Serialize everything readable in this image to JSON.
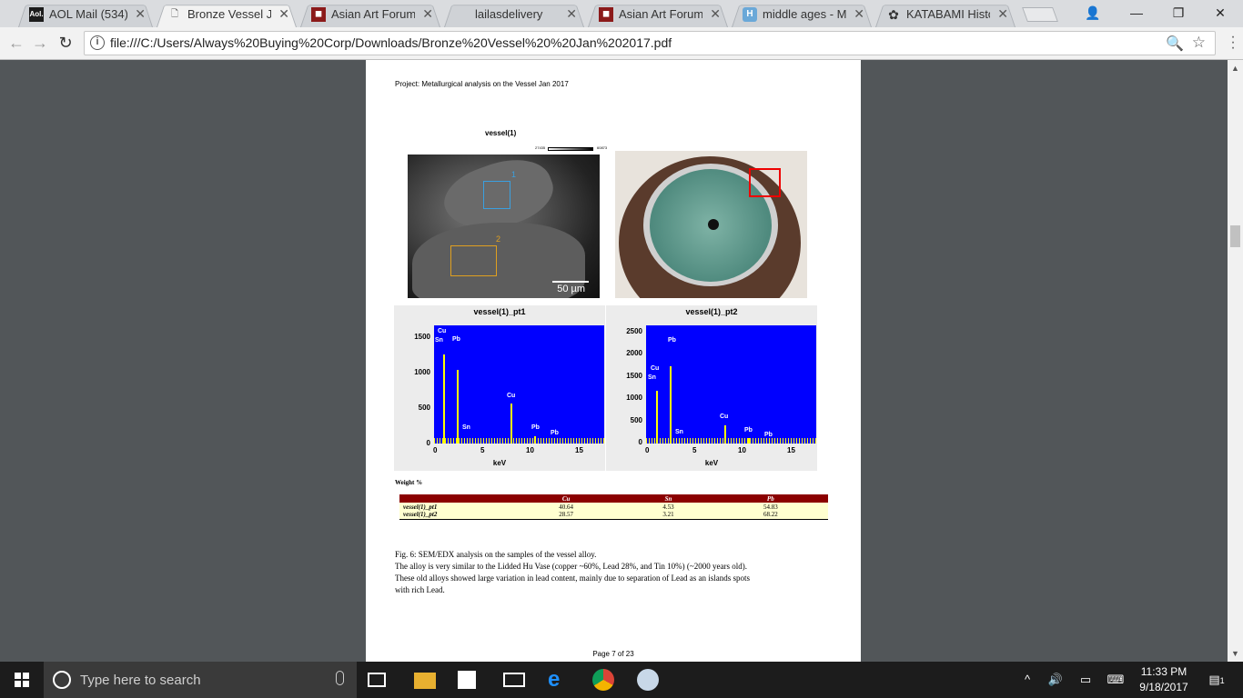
{
  "browser": {
    "tabs": [
      {
        "title": "AOL Mail (534)",
        "icon": "aol-icon",
        "active": false
      },
      {
        "title": "Bronze Vessel Jan",
        "icon": "document-icon",
        "active": true
      },
      {
        "title": "Asian Art Forums -",
        "icon": "forum-icon",
        "active": false
      },
      {
        "title": "lailasdelivery",
        "icon": "",
        "active": false
      },
      {
        "title": "Asian Art Forums -",
        "icon": "forum-icon",
        "active": false
      },
      {
        "title": "middle ages - Me",
        "icon": "h-icon",
        "active": false
      },
      {
        "title": "KATABAMI History",
        "icon": "crest-icon",
        "active": false
      }
    ],
    "url": "file:///C:/Users/Always%20Buying%20Corp/Downloads/Bronze%20Vessel%20%20Jan%202017.pdf"
  },
  "pdf": {
    "project_title": "Project: Metallurgical analysis on the Vessel Jan 2017",
    "sem_title": "vessel(1)",
    "scalebar_min": "27435",
    "scalebar_max": "60873",
    "roi1": "1",
    "roi2": "2",
    "sem_scale": "50 µm",
    "spectra": [
      {
        "title": "vessel(1)_pt1",
        "xlabel": "keV",
        "yticks": [
          "1500",
          "1000",
          "500",
          "0"
        ],
        "xticks": [
          "0",
          "5",
          "10",
          "15"
        ],
        "labels": [
          "Cu",
          "Sn",
          "Pb",
          "Cu",
          "Sn",
          "Pb",
          "Pb"
        ]
      },
      {
        "title": "vessel(1)_pt2",
        "xlabel": "keV",
        "yticks": [
          "2500",
          "2000",
          "1500",
          "1000",
          "500",
          "0"
        ],
        "xticks": [
          "0",
          "5",
          "10",
          "15"
        ],
        "labels": [
          "Pb",
          "Cu",
          "Sn",
          "Cu",
          "Sn",
          "Pb",
          "Pb"
        ]
      }
    ],
    "weight_label": "Weight %",
    "table": {
      "headers": [
        "",
        "Cu",
        "Sn",
        "Pb"
      ],
      "rows": [
        [
          "vessel(1)_pt1",
          "40.64",
          "4.53",
          "54.83"
        ],
        [
          "vessel(1)_pt2",
          "28.57",
          "3.21",
          "68.22"
        ]
      ]
    },
    "caption": [
      "Fig. 6: SEM/EDX analysis on the samples of the vessel alloy.",
      "The alloy is very similar to the Lidded Hu Vase (copper ~60%, Lead 28%, and Tin 10%) (~2000 years old).",
      "These old alloys showed large variation in lead content, mainly due to separation of Lead as an islands spots",
      "with rich Lead."
    ],
    "page_number": "Page 7 of 23"
  },
  "taskbar": {
    "search_placeholder": "Type here to search",
    "time": "11:33 PM",
    "date": "9/18/2017",
    "notification_count": "1"
  }
}
